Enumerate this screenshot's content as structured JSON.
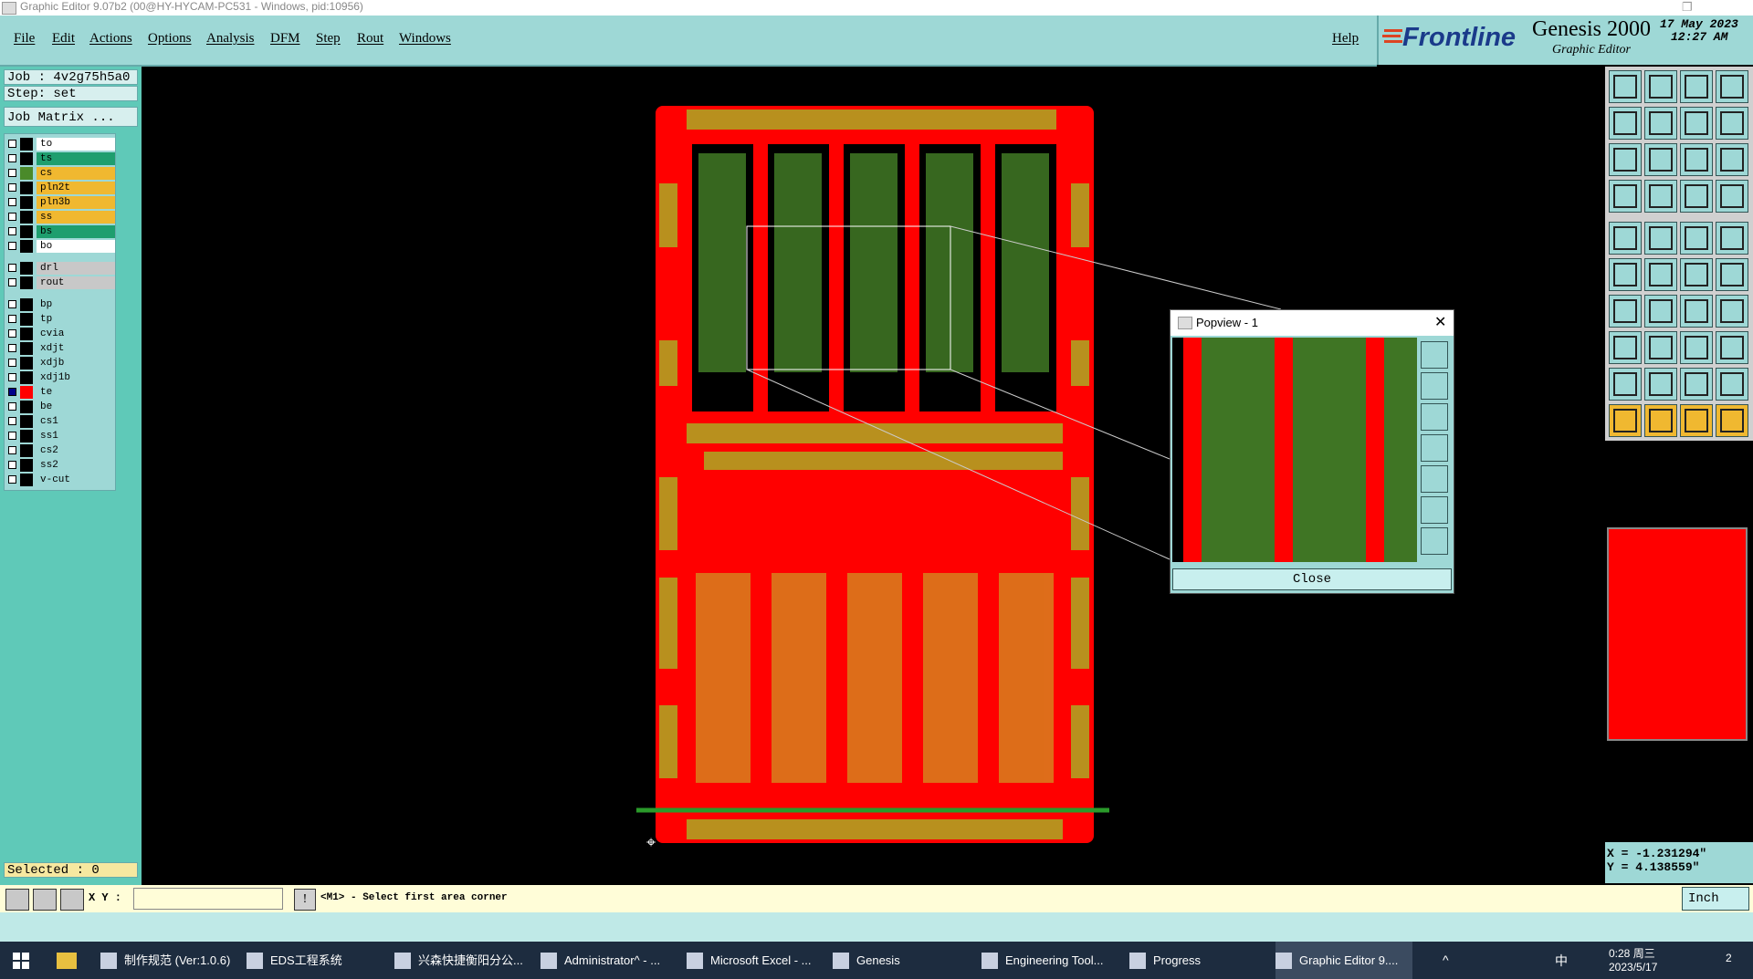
{
  "window": {
    "title": "Graphic Editor 9.07b2 (00@HY-HYCAM-PC531 - Windows, pid:10956)"
  },
  "menu": {
    "items": [
      "File",
      "Edit",
      "Actions",
      "Options",
      "Analysis",
      "DFM",
      "Step",
      "Rout",
      "Windows"
    ],
    "help": "Help"
  },
  "brand": {
    "logo": "Frontline",
    "product": "Genesis 2000",
    "subtitle": "Graphic Editor",
    "date": "17 May 2023",
    "time": "12:27 AM"
  },
  "left": {
    "job_label": "Job : 4v2g75h5a0",
    "step_label": "Step: set",
    "job_matrix": "Job Matrix ...",
    "selected": "Selected : 0",
    "layers": [
      {
        "name": "to",
        "color": "#ffffff",
        "swatch": "#000000",
        "checked": false
      },
      {
        "name": "ts",
        "color": "#1e9e6e",
        "swatch": "#000000",
        "checked": false
      },
      {
        "name": "cs",
        "color": "#f0b830",
        "swatch": "#4a8a2a",
        "checked": false
      },
      {
        "name": "pln2t",
        "color": "#f0b830",
        "swatch": "#000000",
        "checked": false
      },
      {
        "name": "pln3b",
        "color": "#f0b830",
        "swatch": "#000000",
        "checked": false
      },
      {
        "name": "ss",
        "color": "#f0b830",
        "swatch": "#000000",
        "checked": false
      },
      {
        "name": "bs",
        "color": "#1e9e6e",
        "swatch": "#000000",
        "checked": false
      },
      {
        "name": "bo",
        "color": "#ffffff",
        "swatch": "#000000",
        "checked": false
      },
      {
        "name": "drl",
        "color": "#c8c8c8",
        "swatch": "#000000",
        "checked": false
      },
      {
        "name": "rout",
        "color": "#c8c8c8",
        "swatch": "#000000",
        "checked": false
      },
      {
        "name": "bp",
        "color": "#9ed8d6",
        "swatch": "#000000",
        "checked": false
      },
      {
        "name": "tp",
        "color": "#9ed8d6",
        "swatch": "#000000",
        "checked": false
      },
      {
        "name": "cvia",
        "color": "#9ed8d6",
        "swatch": "#000000",
        "checked": false
      },
      {
        "name": "xdjt",
        "color": "#9ed8d6",
        "swatch": "#000000",
        "checked": false
      },
      {
        "name": "xdjb",
        "color": "#9ed8d6",
        "swatch": "#000000",
        "checked": false
      },
      {
        "name": "xdj1b",
        "color": "#9ed8d6",
        "swatch": "#000000",
        "checked": false
      },
      {
        "name": "te",
        "color": "#9ed8d6",
        "swatch": "#ff0000",
        "checked": true
      },
      {
        "name": "be",
        "color": "#9ed8d6",
        "swatch": "#000000",
        "checked": false
      },
      {
        "name": "cs1",
        "color": "#9ed8d6",
        "swatch": "#000000",
        "checked": false
      },
      {
        "name": "ss1",
        "color": "#9ed8d6",
        "swatch": "#000000",
        "checked": false
      },
      {
        "name": "cs2",
        "color": "#9ed8d6",
        "swatch": "#000000",
        "checked": false
      },
      {
        "name": "ss2",
        "color": "#9ed8d6",
        "swatch": "#000000",
        "checked": false
      },
      {
        "name": "v-cut",
        "color": "#9ed8d6",
        "swatch": "#000000",
        "checked": false
      }
    ]
  },
  "popview": {
    "title": "Popview - 1",
    "close": "Close"
  },
  "coords": {
    "x": "X = -1.231294\"",
    "y": "Y = 4.138559\""
  },
  "command": {
    "xy_label": "X Y :",
    "xy_value": "",
    "prompt": "<M1> - Select first area corner",
    "units": "Inch"
  },
  "colors": {
    "board": "#ff0000",
    "copper_top": "#4a8a2a",
    "gold": "#b8901e",
    "panel": "#9ed8d6"
  },
  "taskbar": {
    "items": [
      {
        "label": "制作规范 (Ver:1.0.6)",
        "icon": "document-icon"
      },
      {
        "label": "EDS工程系统",
        "icon": "f-icon"
      },
      {
        "label": "兴森快捷衡阳分公...",
        "icon": "chat-icon"
      },
      {
        "label": "Administrator^ - ...",
        "icon": "save-icon"
      },
      {
        "label": "Microsoft Excel - ...",
        "icon": "excel-icon"
      },
      {
        "label": "Genesis",
        "icon": "genesis-icon"
      },
      {
        "label": "Engineering Tool...",
        "icon": "x-icon"
      },
      {
        "label": "Progress",
        "icon": "x-icon"
      },
      {
        "label": "Graphic Editor 9....",
        "icon": "x-icon"
      }
    ],
    "time": "0:28 周三",
    "date": "2023/5/17",
    "ime": "中",
    "notification_count": "2"
  }
}
